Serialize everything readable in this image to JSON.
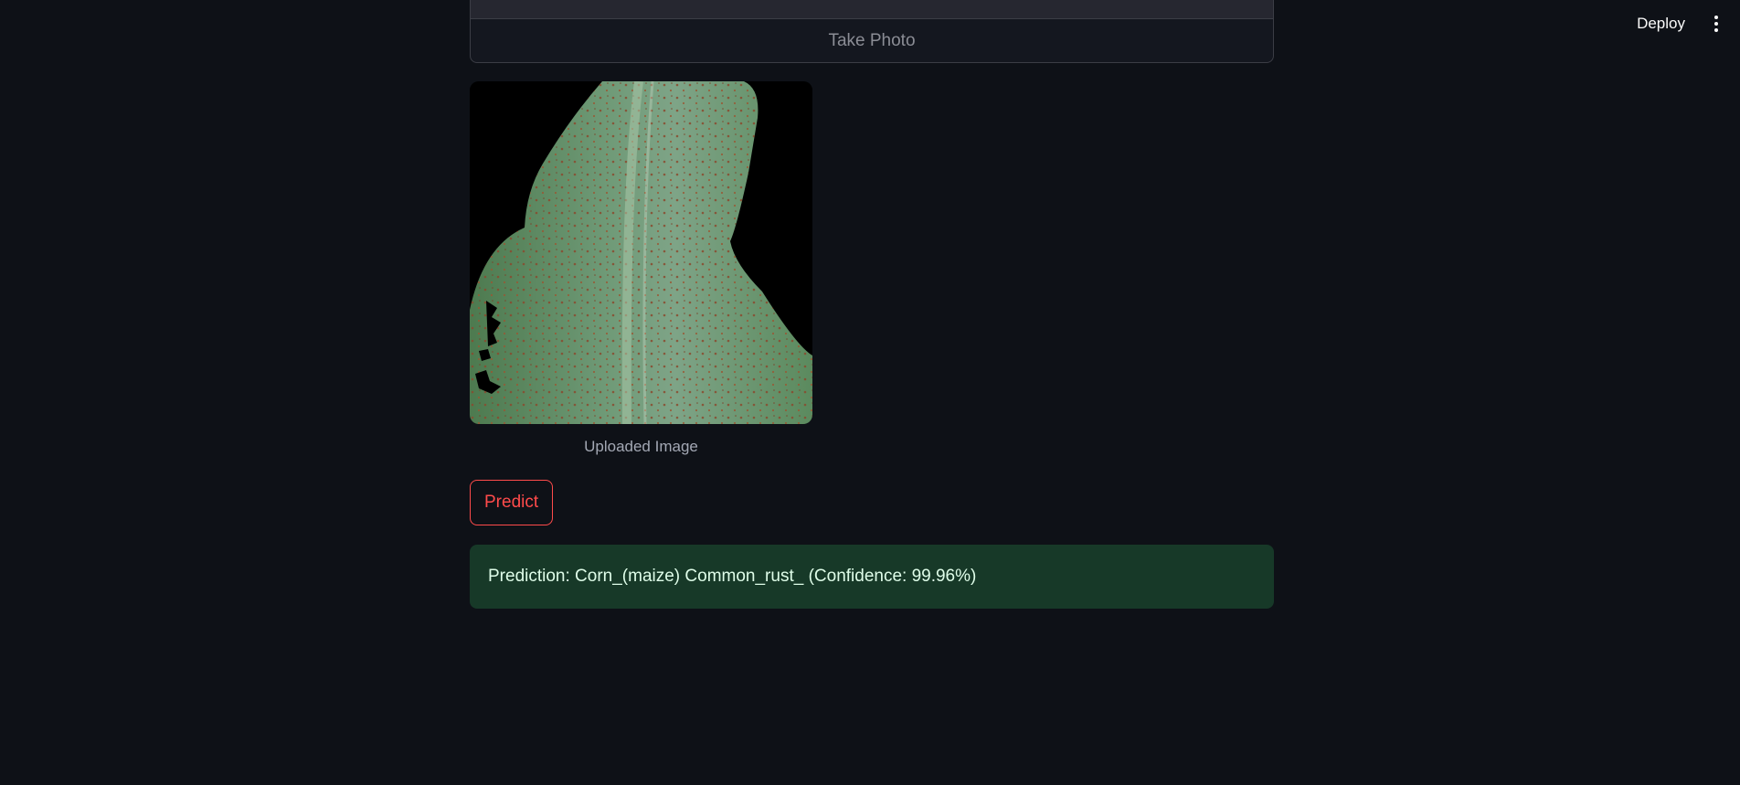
{
  "header": {
    "deploy_label": "Deploy",
    "menu_icon": "more-vertical-icon"
  },
  "camera": {
    "take_photo_label": "Take Photo"
  },
  "uploaded_image": {
    "caption": "Uploaded Image"
  },
  "predict": {
    "label": "Predict",
    "accent_color": "#ff4b4b"
  },
  "result": {
    "text": "Prediction: Corn_(maize) Common_rust_ (Confidence: 99.96%)",
    "background_color": "#173928"
  }
}
